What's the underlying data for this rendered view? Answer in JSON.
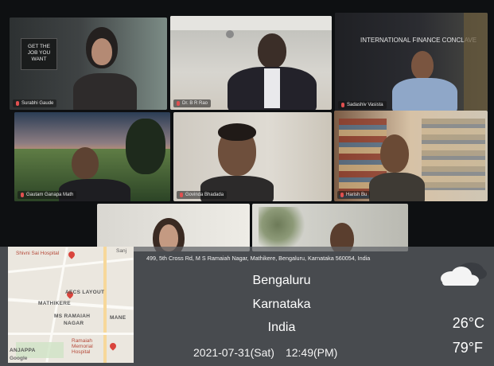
{
  "participants": [
    {
      "name": "Surabhi Gaude"
    },
    {
      "name": "Dr. B R Rao"
    },
    {
      "name": "Sadashiv Vasista"
    },
    {
      "name": "Gautam Ganapa Math"
    },
    {
      "name": "Govinda Bhadada"
    },
    {
      "name": "Harish Bu"
    }
  ],
  "tiles": {
    "poster_text": "GET THE\nJOB YOU\nWANT",
    "banner_text": "INTERNATIONAL FINANCE CONCLAVE"
  },
  "location_stamp": {
    "address": "499, 5th Cross Rd, M S Ramaiah Nagar, Mathikere, Bengaluru, Karnataka 560054, India",
    "city": "Bengaluru",
    "state": "Karnataka",
    "country": "India",
    "date": "2021-07-31(Sat)",
    "time": "12:49(PM)",
    "temp_c": "26°C",
    "temp_f": "79°F",
    "weather_icon": "cloudy-icon"
  },
  "map": {
    "labels": {
      "hospital_top": "Shivni Sai Hospital",
      "road_top": "Sanj",
      "layout": "AECS LAYOUT",
      "area1": "MATHIKERE",
      "area2": "MS RAMAIAH",
      "area3": "NAGAR",
      "area4": "MANE",
      "hospital_bottom": "Ramaiah Memorial Hospital",
      "area5": "ANJAPPA",
      "google": "Google"
    }
  },
  "colors": {
    "map_bg": "#ebe7df",
    "pin_red": "#d9443c",
    "stamp_bg": "#5f6266"
  }
}
